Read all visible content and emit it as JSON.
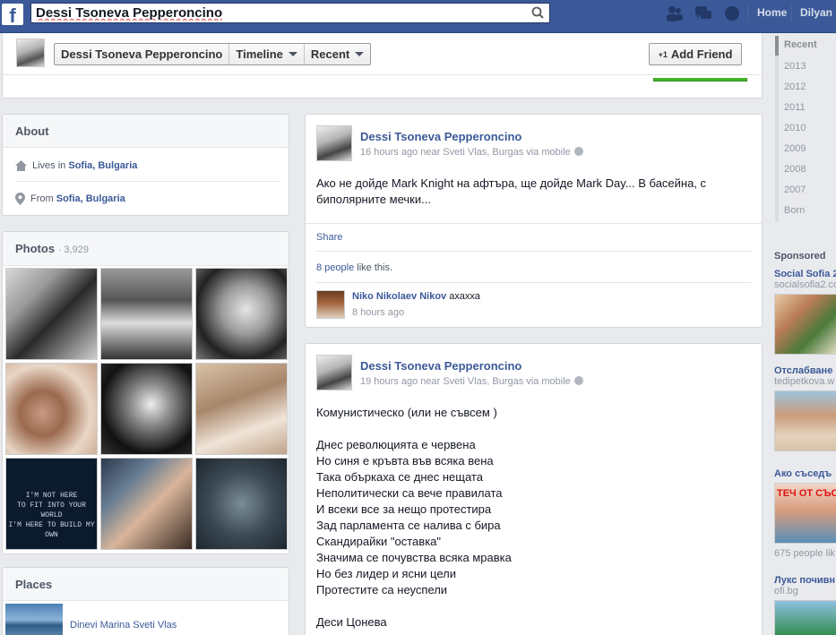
{
  "topbar": {
    "logo": "f",
    "search_value": "Dessi Tsoneva Pepperoncino",
    "nav_home": "Home",
    "nav_user": "Dilyan"
  },
  "profile": {
    "name_btn": "Dessi Tsoneva Pepperoncino",
    "timeline_btn": "Timeline",
    "recent_btn": "Recent",
    "add_friend": "Add Friend",
    "add_friend_icon": "+1"
  },
  "about": {
    "title": "About",
    "lives_prefix": "Lives in",
    "lives_place": "Sofia, Bulgaria",
    "from_prefix": "From",
    "from_place": "Sofia, Bulgaria"
  },
  "photos": {
    "title": "Photos",
    "count": "· 3,929",
    "text_photo_lines": [
      "I'M NOT HERE",
      "TO FIT INTO YOUR WORLD",
      "I'M HERE TO BUILD MY OWN"
    ]
  },
  "places": {
    "title": "Places",
    "item": "Dinevi Marina Sveti Vlas"
  },
  "timeline": {
    "items": [
      "Recent",
      "2013",
      "2012",
      "2011",
      "2010",
      "2009",
      "2008",
      "2007",
      "Born"
    ]
  },
  "posts": [
    {
      "name": "Dessi Tsoneva Pepperoncino",
      "meta": "16 hours ago near Sveti Vlas, Burgas via mobile",
      "text": "Ако не дойде Mark Knight на афтъра, ще дойде Mark Day... В басейна, с биполярните мечки...",
      "share": "Share",
      "likes_count": "8 people",
      "likes_suffix": " like this.",
      "comment_name": "Niko Nikolaev Nikov",
      "comment_text": "ахахха",
      "comment_time": "8 hours ago"
    },
    {
      "name": "Dessi Tsoneva Pepperoncino",
      "meta": "19 hours ago near Sveti Vlas, Burgas via mobile",
      "text": "Комунистическо (или не съвсем )\n\nДнес революцията е червена\nНо синя е кръвта във всяка вена\nТака объркаха се днес нещата\nНеполитически са вече правилата\nИ всеки все за нещо протестира\nЗад парламента се налива с бира\nСкандирайки \"оставка\"\nЗначима се почувства всяка мравка\nНо без лидер и ясни цели\nПротестите са неуспели\n\nДеси Цонева"
    }
  ],
  "sponsored": {
    "title": "Sponsored",
    "ads": [
      {
        "title": "Social Sofia 2",
        "url": "socialsofia2.co"
      },
      {
        "title": "Отслабване",
        "url": "tedipetkova.w"
      },
      {
        "title": "Ако съседъ",
        "img_text": "ТЕЧ ОТ СЪС",
        "likes": "675 people lik"
      },
      {
        "title": "Лукс почивн",
        "url": "ofi.bg"
      }
    ]
  },
  "colors": {
    "brand": "#3b5998",
    "bg": "#e9eaed",
    "green": "#42b72a"
  }
}
